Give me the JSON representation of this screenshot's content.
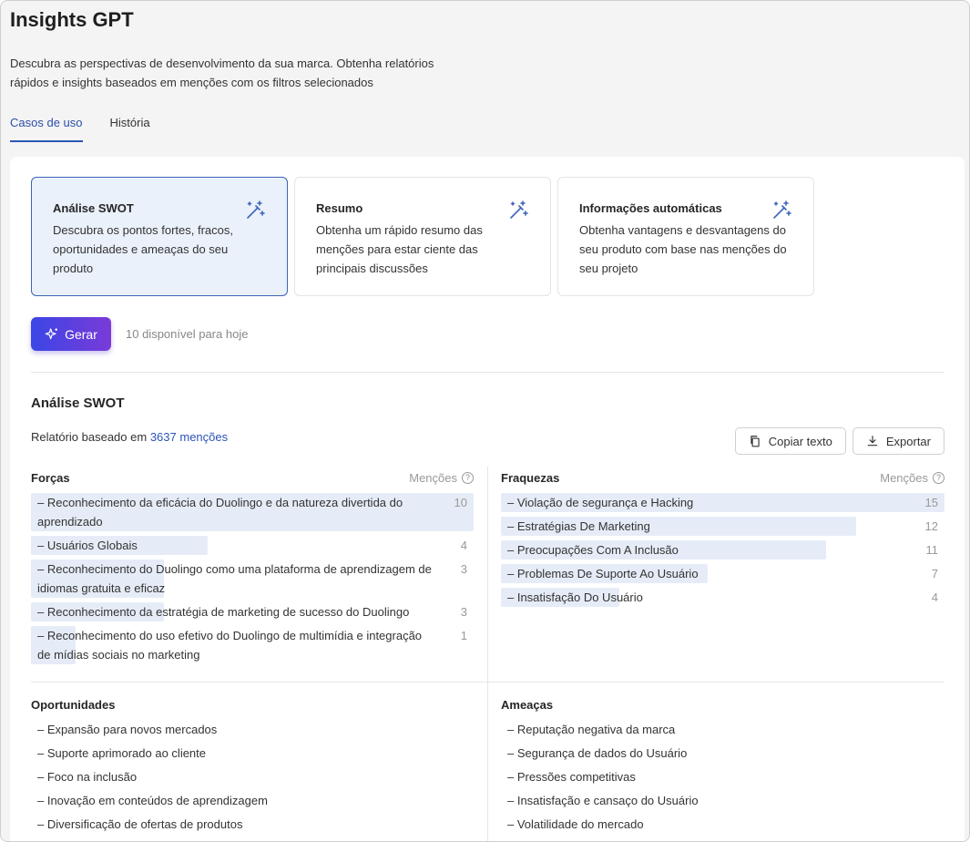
{
  "header": {
    "title": "Insights GPT",
    "subtitle": "Descubra as perspectivas de desenvolvimento da sua marca. Obtenha relatórios rápidos e insights baseados em menções com os filtros selecionados"
  },
  "tabs": [
    {
      "label": "Casos de uso",
      "active": true
    },
    {
      "label": "História",
      "active": false
    }
  ],
  "cards": [
    {
      "title": "Análise SWOT",
      "desc": "Descubra os pontos fortes, fracos, oportunidades e ameaças do seu produto",
      "icon": "magic-wand-icon",
      "selected": true
    },
    {
      "title": "Resumo",
      "desc": "Obtenha um rápido resumo das menções para estar ciente das principais discussões",
      "icon": "magic-wand-icon",
      "selected": false
    },
    {
      "title": "Informações automáticas",
      "desc": "Obtenha vantagens e desvantagens do seu produto com base nas menções do seu projeto",
      "icon": "magic-wand-icon",
      "selected": false
    }
  ],
  "generate": {
    "label": "Gerar",
    "icon": "sparkle-icon",
    "note": "10 disponível para hoje"
  },
  "result": {
    "title": "Análise SWOT",
    "report_prefix": "Relatório baseado em",
    "report_count": "3637 menções",
    "copy_label": "Copiar texto",
    "export_label": "Exportar"
  },
  "mentions_label": "Menções",
  "strengths": {
    "title": "Forças",
    "items": [
      {
        "text": "– Reconhecimento da eficácia do Duolingo e da natureza divertida do aprendizado",
        "count": 10,
        "fill": 1.0
      },
      {
        "text": "– Usuários Globais",
        "count": 4,
        "fill": 0.4
      },
      {
        "text": "– Reconhecimento do Duolingo como uma plataforma de aprendizagem de idiomas gratuita e eficaz",
        "count": 3,
        "fill": 0.3
      },
      {
        "text": "– Reconhecimento da estratégia de marketing de sucesso do Duolingo",
        "count": 3,
        "fill": 0.3
      },
      {
        "text": "– Reconhecimento do uso efetivo do Duolingo de multimídia e integração de mídias sociais no marketing",
        "count": 1,
        "fill": 0.1
      }
    ]
  },
  "weaknesses": {
    "title": "Fraquezas",
    "items": [
      {
        "text": "– Violação de segurança e Hacking",
        "count": 15,
        "fill": 1.0
      },
      {
        "text": "– Estratégias De Marketing",
        "count": 12,
        "fill": 0.8
      },
      {
        "text": "– Preocupações Com A Inclusão",
        "count": 11,
        "fill": 0.733
      },
      {
        "text": "– Problemas De Suporte Ao Usuário",
        "count": 7,
        "fill": 0.467
      },
      {
        "text": "– Insatisfação Do Usuário",
        "count": 4,
        "fill": 0.267
      }
    ]
  },
  "opportunities": {
    "title": "Oportunidades",
    "items": [
      "– Expansão para novos mercados",
      "– Suporte aprimorado ao cliente",
      "– Foco na inclusão",
      "– Inovação em conteúdos de aprendizagem",
      "– Diversificação de ofertas de produtos"
    ]
  },
  "threats": {
    "title": "Ameaças",
    "items": [
      "– Reputação negativa da marca",
      "– Segurança de dados do Usuário",
      "– Pressões competitivas",
      "– Insatisfação e cansaço do Usuário",
      "– Volatilidade do mercado"
    ]
  },
  "colors": {
    "accent": "#2b55b8",
    "bar": "#e6ecf7",
    "gradient_start": "#3b46e6",
    "gradient_end": "#7a3ad8"
  }
}
